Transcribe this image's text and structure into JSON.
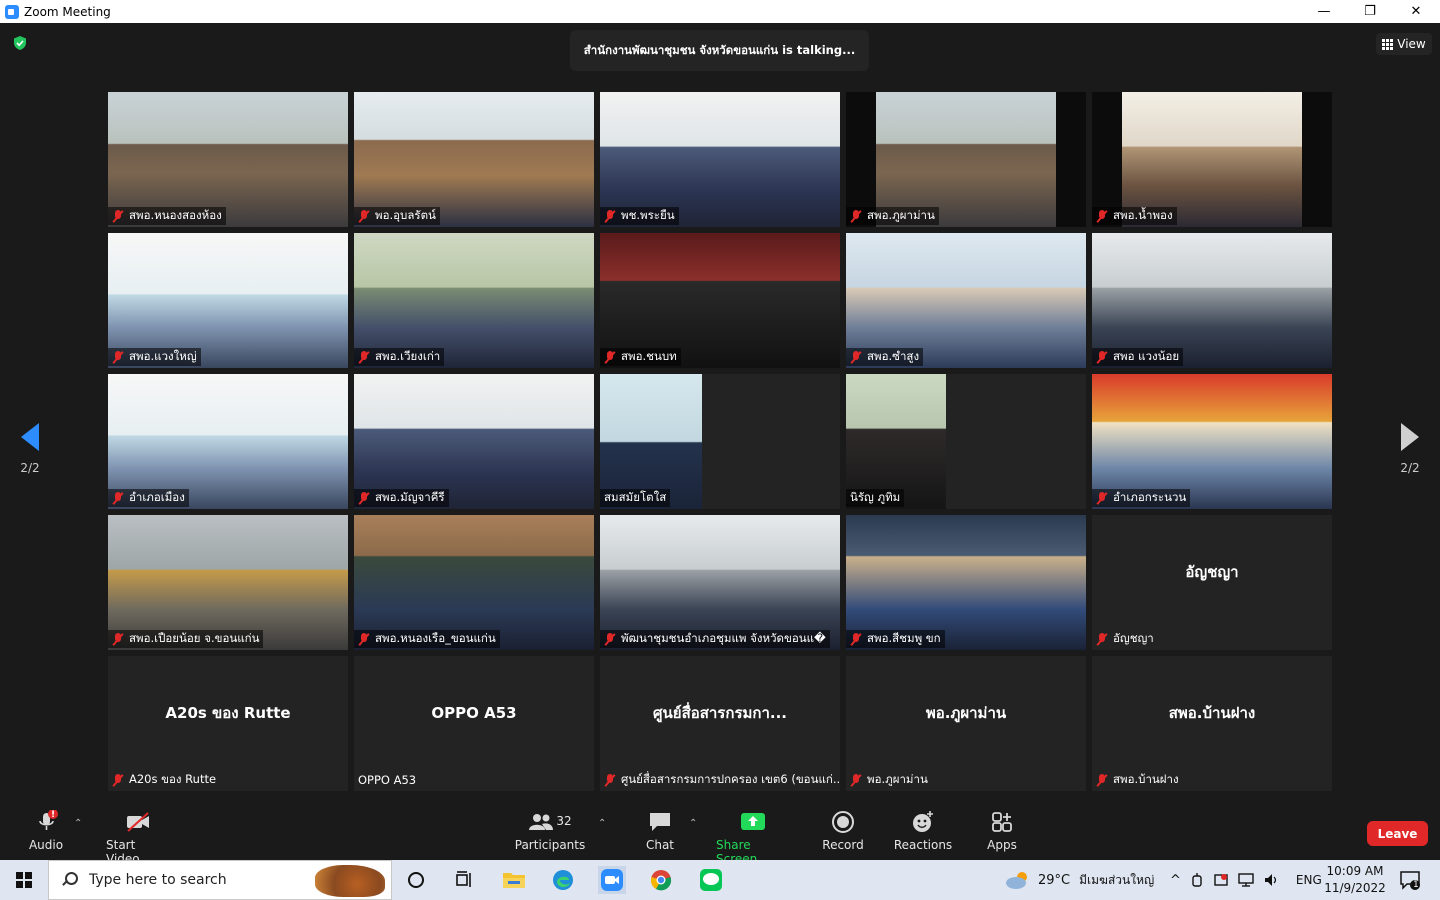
{
  "window": {
    "title": "Zoom Meeting",
    "minimize": "—",
    "maximize": "❐",
    "close": "✕"
  },
  "meeting": {
    "talking_text": "สำนักงานพัฒนาชุมชน จังหวัดขอนแก่น is talking...",
    "view_label": "View",
    "page_indicator_left": "2/2",
    "page_indicator_right": "2/2"
  },
  "tiles": [
    {
      "name": "สพอ.หนองสองห้อง",
      "muted": true,
      "scene": "room"
    },
    {
      "name": "พอ.อุบลรัตน์",
      "muted": true,
      "scene": "room2"
    },
    {
      "name": "พช.พระยืน",
      "muted": true,
      "scene": "room3"
    },
    {
      "name": "สพอ.ภูผาม่าน",
      "muted": true,
      "scene": "room side-black"
    },
    {
      "name": "สพอ.น้ำพอง",
      "muted": true,
      "scene": "room8 side-black"
    },
    {
      "name": "สพอ.แวงใหญ่",
      "muted": true,
      "scene": "room6"
    },
    {
      "name": "สพอ.เวียงเก่า",
      "muted": true,
      "scene": "room7"
    },
    {
      "name": "สพอ.ชนบท",
      "muted": true,
      "scene": "room4"
    },
    {
      "name": "สพอ.ซำสูง",
      "muted": true,
      "scene": "room5"
    },
    {
      "name": "สพอ แวงน้อย",
      "muted": true,
      "scene": "room10"
    },
    {
      "name": "อำเภอเมือง",
      "muted": true,
      "scene": "room6"
    },
    {
      "name": "สพอ.มัญจาคีรี",
      "muted": true,
      "scene": "room3"
    },
    {
      "name": "สมสมัยโตใส",
      "muted": false,
      "scene": "portrait"
    },
    {
      "name": "นิรัญ ภูทิม",
      "muted": false,
      "scene": "portrait2"
    },
    {
      "name": "อำเภอกระนวน",
      "muted": true,
      "scene": "room9"
    },
    {
      "name": "สพอ.เปือยน้อย จ.ขอนแก่น",
      "muted": true,
      "scene": "room12"
    },
    {
      "name": "สพอ.หนองเรือ_ขอนแก่น",
      "muted": true,
      "scene": "room11"
    },
    {
      "name": "พัฒนาชุมชนอำเภอชุมแพ จังหวัดขอนแ�",
      "muted": true,
      "scene": "room10"
    },
    {
      "name": "สพอ.สีชมพู ขก",
      "muted": true,
      "scene": "room13"
    },
    {
      "name": "อัญชญา",
      "muted": true,
      "center": "อัญชญา",
      "scene": ""
    },
    {
      "name": "A20s ของ Rutte",
      "muted": true,
      "center": "A20s ของ Rutte",
      "scene": ""
    },
    {
      "name": "OPPO A53",
      "muted": false,
      "center": "OPPO A53",
      "scene": ""
    },
    {
      "name": "ศูนย์สื่อสารกรมการปกครอง เขต6 (ขอนแก่...",
      "muted": true,
      "center": "ศูนย์สื่อสารกรมกา...",
      "scene": ""
    },
    {
      "name": "พอ.ภูผาม่าน",
      "muted": true,
      "center": "พอ.ภูผาม่าน",
      "scene": ""
    },
    {
      "name": "สพอ.บ้านฝาง",
      "muted": true,
      "center": "สพอ.บ้านฝาง",
      "scene": ""
    }
  ],
  "toolbar": {
    "audio": "Audio",
    "start_video": "Start Video",
    "participants": "Participants",
    "participants_count": "32",
    "chat": "Chat",
    "share_screen": "Share Screen",
    "record": "Record",
    "reactions": "Reactions",
    "apps": "Apps",
    "leave": "Leave",
    "audio_alert": "!"
  },
  "taskbar": {
    "search_placeholder": "Type here to search",
    "weather": "29°C",
    "weather_place": "มีเมฆส่วนใหญ่",
    "language": "ENG",
    "time": "10:09 AM",
    "date": "11/9/2022",
    "notifications": "1"
  },
  "colors": {
    "accent": "#2d8cff",
    "danger": "#e02828",
    "share_green": "#23d959",
    "background": "#1a1a1a"
  }
}
